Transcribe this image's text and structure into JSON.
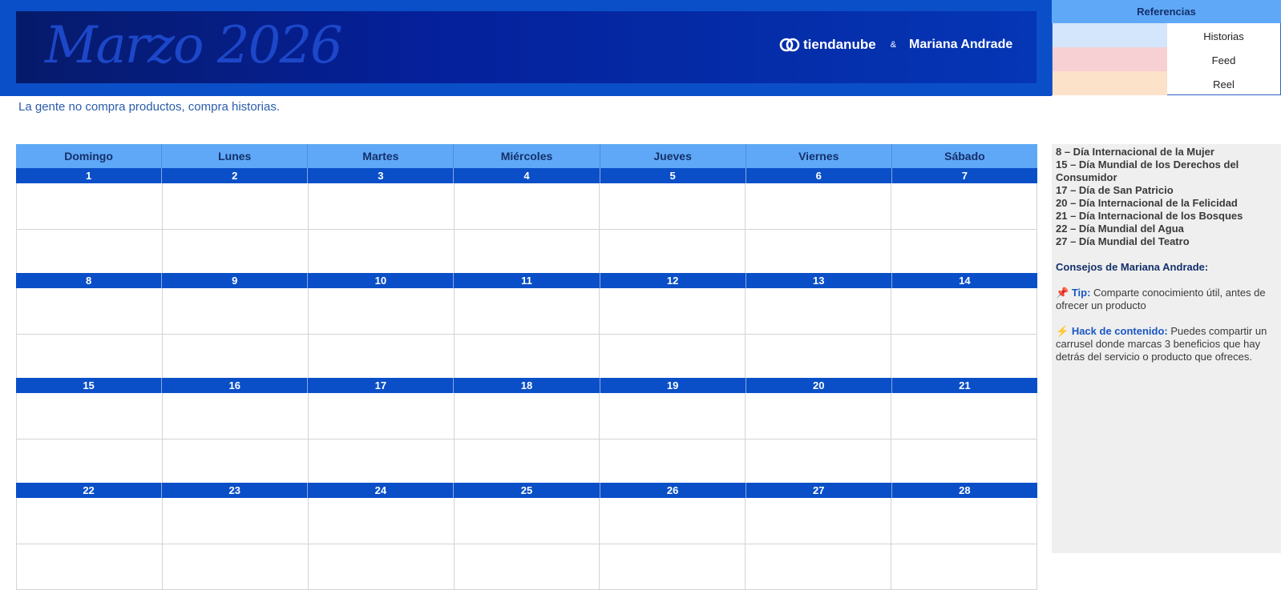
{
  "header": {
    "month_title": "Marzo 2026",
    "brand_name": "tiendanube",
    "ampersand": "&",
    "partner_name": "Mariana Andrade",
    "tagline": "La gente no compra productos, compra historias."
  },
  "references": {
    "title": "Referencias",
    "items": [
      {
        "label": "Historias",
        "color": "#d3e6fb"
      },
      {
        "label": "Feed",
        "color": "#f6d0d3"
      },
      {
        "label": "Reel",
        "color": "#fbe2c9"
      }
    ]
  },
  "calendar": {
    "weekdays": [
      "Domingo",
      "Lunes",
      "Martes",
      "Miércoles",
      "Jueves",
      "Viernes",
      "Sábado"
    ],
    "weeks": [
      [
        "1",
        "2",
        "3",
        "4",
        "5",
        "6",
        "7"
      ],
      [
        "8",
        "9",
        "10",
        "11",
        "12",
        "13",
        "14"
      ],
      [
        "15",
        "16",
        "17",
        "18",
        "19",
        "20",
        "21"
      ],
      [
        "22",
        "23",
        "24",
        "25",
        "26",
        "27",
        "28"
      ]
    ]
  },
  "sidebar": {
    "events": [
      "8 – Día Internacional de la Mujer",
      "15 – Día Mundial de los Derechos del Consumidor",
      "17 – Día de San Patricio",
      "20 – Día Internacional de la Felicidad",
      "21 – Día Internacional de los Bosques",
      "22 – Día Mundial del Agua",
      "27 – Día Mundial del Teatro"
    ],
    "advice_title": "Consejos de Mariana Andrade:",
    "tip_icon": "📌",
    "tip_label": "Tip:",
    "tip_text": "Comparte conocimiento útil, antes de ofrecer un producto",
    "hack_icon": "⚡",
    "hack_label": "Hack de contenido:",
    "hack_text": "Puedes compartir un carrusel donde marcas 3 beneficios que hay detrás del servicio o producto que ofreces."
  },
  "colors": {
    "primary_blue": "#0a4fc7",
    "light_blue": "#5fa8f7",
    "navy": "#14306a"
  }
}
